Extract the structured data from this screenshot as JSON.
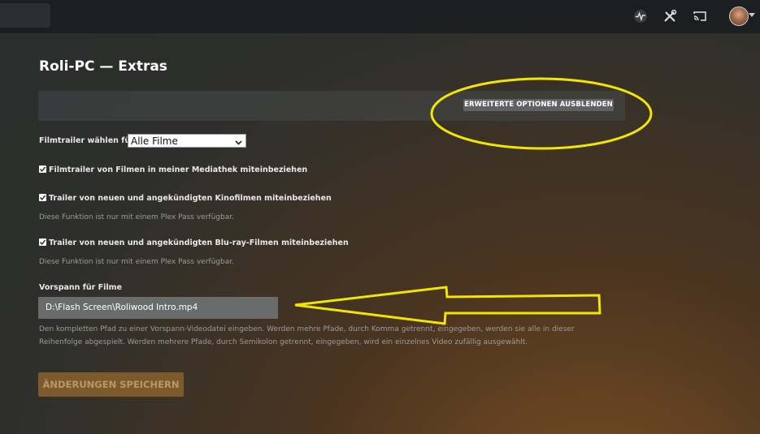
{
  "page": {
    "title": "Roli-PC — Extras"
  },
  "icons": {
    "activity": "activity-icon",
    "tools": "tools-icon",
    "cast": "cast-icon",
    "avatar": "user-avatar"
  },
  "advanced": {
    "toggle_label": "ERWEITERTE OPTIONEN AUSBLENDEN"
  },
  "trailer_select": {
    "label": "Filmtrailer wählen für",
    "value": "Alle Filme"
  },
  "checkboxes": [
    {
      "label": "Filmtrailer von Filmen in meiner Mediathek miteinbeziehen",
      "checked": true
    },
    {
      "label": "Trailer von neuen und angekündigten Kinofilmen miteinbeziehen",
      "checked": true,
      "note": "Diese Funktion ist nur mit einem Plex Pass verfügbar."
    },
    {
      "label": "Trailer von neuen und angekündigten Blu-ray-Filmen miteinbeziehen",
      "checked": true,
      "note": "Diese Funktion ist nur mit einem Plex Pass verfügbar."
    }
  ],
  "preroll": {
    "label": "Vorspann für Filme",
    "value": "D:\\Flash Screen\\Roliwood Intro.mp4",
    "help_line1": "Den kompletten Pfad zu einer Vorspann-Videodatei eingeben. Werden mehre Pfade, durch Komma getrennt, eingegeben, werden sie alle in dieser",
    "help_line2": "Reihenfolge abgespielt. Werden mehrere Pfade, durch Semikolon getrennt, eingegeben, wird ein einzelnes Video zufällig ausgewählt."
  },
  "save": {
    "label": "ÄNDERUNGEN SPEICHERN"
  },
  "colors": {
    "annotation": "#f2e600",
    "save_button": "#7d5a2d",
    "topbar": "#1c1f21"
  }
}
